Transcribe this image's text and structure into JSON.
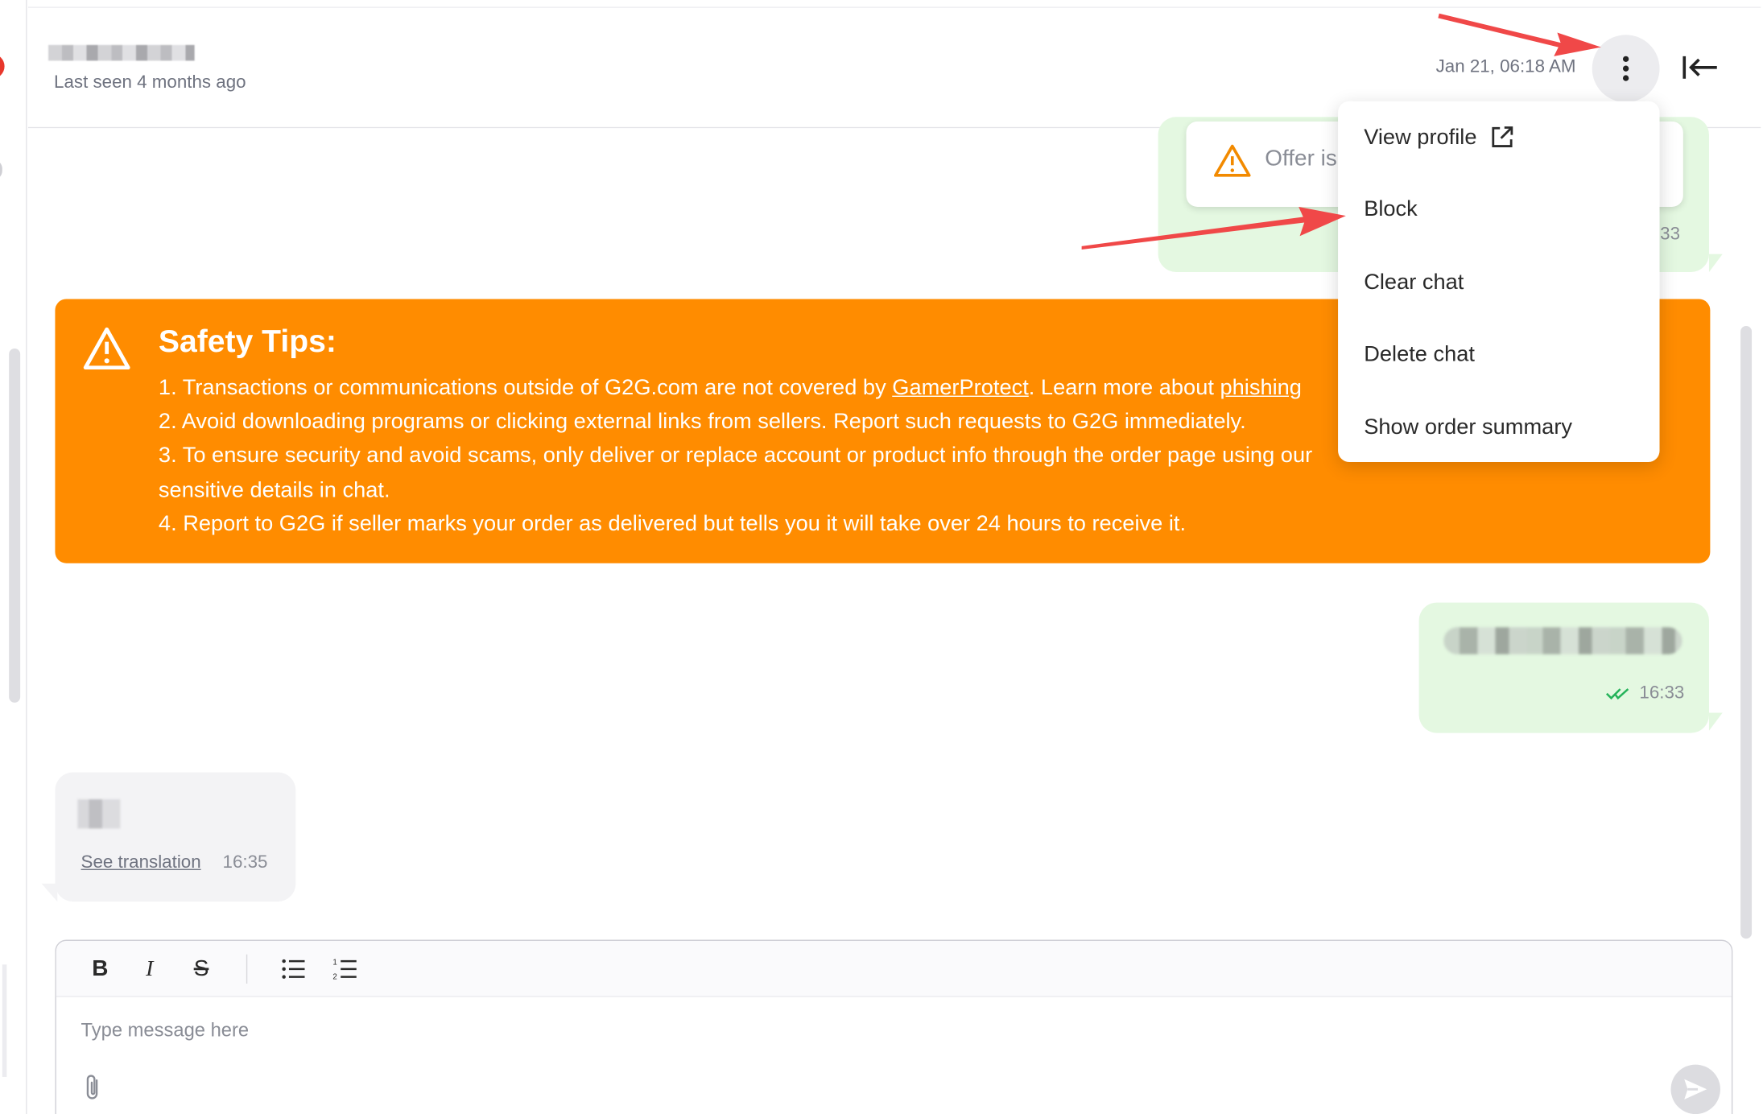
{
  "header": {
    "last_seen": "Last seen 4 months ago",
    "timestamp": "Jan 21, 06:18 AM",
    "more_icon": "kebab-vertical-icon",
    "collapse_icon": "collapse-left-icon"
  },
  "menu": {
    "items": [
      {
        "label": "View profile",
        "icon": "external-link-icon"
      },
      {
        "label": "Block"
      },
      {
        "label": "Clear chat"
      },
      {
        "label": "Delete chat"
      },
      {
        "label": "Show order summary"
      }
    ]
  },
  "messages": {
    "offer_text": "Offer is",
    "offer_time": ":33",
    "mid_time": "16:33",
    "left_see_translation": "See translation",
    "left_time": "16:35"
  },
  "safety": {
    "title": "Safety Tips:",
    "line1_a": "1. Transactions or communications outside of G2G.com are not covered by ",
    "line1_link": "GamerProtect",
    "line1_b": ". Learn more about ",
    "line1_link2": "phishing",
    "line2": "2. Avoid downloading programs or clicking external links from sellers. Report such requests to G2G immediately.",
    "line3a": "3. To ensure security and avoid scams, only deliver or replace account or product info through the order page using our",
    "line3b": "sensitive details in chat.",
    "line4": "4. Report to G2G if seller marks your order as delivered but tells you it will take over 24 hours to receive it."
  },
  "composer": {
    "placeholder": "Type message here",
    "toolbar": [
      "B",
      "I",
      "S"
    ]
  },
  "colors": {
    "safety_bg": "#ff8c00",
    "sent_bubble": "#e4f8e1",
    "received_bubble": "#f3f3f5",
    "annotation": "#f04848",
    "read_check": "#25b35a"
  }
}
